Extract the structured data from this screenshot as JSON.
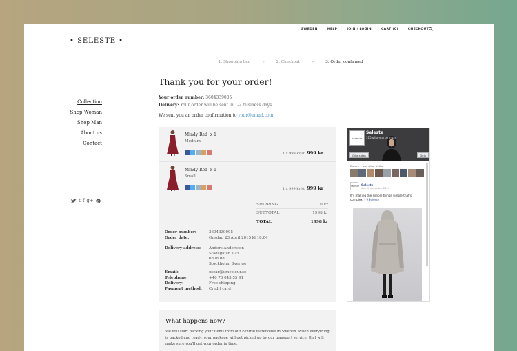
{
  "brand": {
    "logo": "• SELESTE •"
  },
  "topnav": [
    "SWEDEN",
    "HELP",
    "JOIN / LOGIN",
    "CART (0)",
    "CHECKOUT"
  ],
  "steps": {
    "step1": "1. Shopping bag",
    "step2": "2. Checkout",
    "step3": "3. Order confirmed",
    "sep": "»"
  },
  "leftnav": [
    "Collection",
    "Shop Woman",
    "Shop Man",
    "About us",
    "Contact"
  ],
  "social": [
    "t",
    "f",
    "g+"
  ],
  "main": {
    "title": "Thank you for your order!",
    "order_number_label": "Your order number:",
    "order_number": "3604339005",
    "delivery_label": "Delivery:",
    "delivery_text": "Your order will be sent in 1-2 business days.",
    "confirmation_text": "We sent you an order confirmation to",
    "email_link": "your@email.com"
  },
  "cart": {
    "items": [
      {
        "name": "Mindy Red",
        "qty_x": "x 1",
        "size": "Medium",
        "unit": "1 x 999 kr/st",
        "price": "999 kr"
      },
      {
        "name": "Mindy Red",
        "qty_x": "x 1",
        "size": "Small",
        "unit": "1 x 999 kr/st",
        "price": "999 kr"
      }
    ],
    "shipping_label": "SHIPPING",
    "shipping_value": "0 kr",
    "subtotal_label": "SUBTOTAL",
    "subtotal_value": "1998 kr",
    "total_label": "TOTAL",
    "total_value": "1998 kr"
  },
  "details": {
    "order_number_k": "Order number:",
    "order_number_v": "3604339005",
    "order_date_k": "Order date:",
    "order_date_v": "Onsdag 23 April 2015 kl 18:04",
    "address_k": "Delivery address:",
    "address_lines": [
      "Anders Andersson",
      "Stadsgatan 125",
      "0808 08",
      "Stockholm, Sverige"
    ],
    "email_k": "Email:",
    "email_v": "oscar@umcolour.se",
    "phone_k": "Telephone:",
    "phone_v": "+46 76 043 55 91",
    "delivery_k": "Delivery:",
    "delivery_v": "Free shipping",
    "payment_k": "Payment method:",
    "payment_v": "Credit card"
  },
  "facebook": {
    "page_name": "Seleste",
    "page_sub": "315 gilla-markeringar",
    "logo_text": "SELESTE",
    "like_label": "Gilla sidan",
    "share_label": "Dela",
    "likers_text": "Du och 1 vän gillar detta.",
    "post_name": "Seleste",
    "post_date": "den 11 december 2014",
    "post_text": "It's making the simple things simple that's complex.",
    "post_tag": "#Seleste"
  },
  "happens": {
    "title": "What happens now?",
    "text": "We will start packing your items from our central warehouse in Sweden. When everything is packed and ready, your package will get picked up by our transport service, that will make sure you'll get your order in time."
  }
}
